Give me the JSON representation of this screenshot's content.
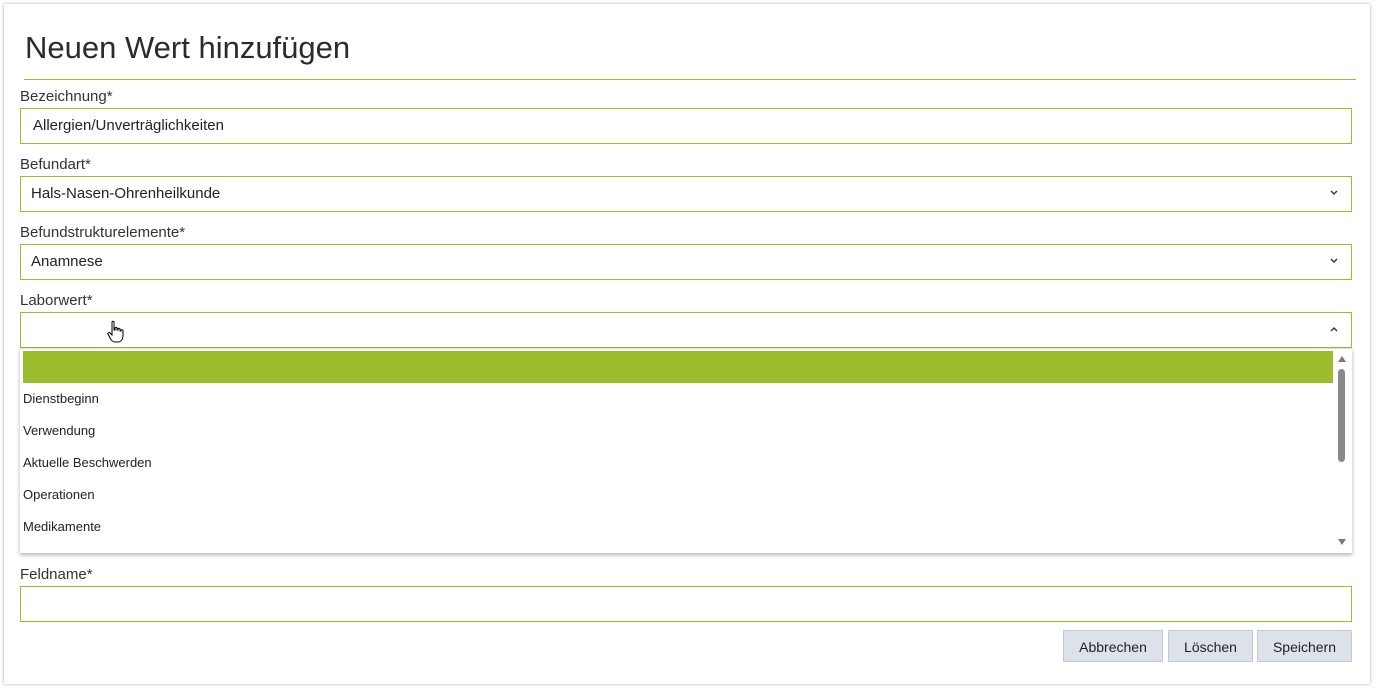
{
  "dialog": {
    "title": "Neuen Wert hinzufügen"
  },
  "fields": {
    "bezeichnung": {
      "label": "Bezeichnung*",
      "value": "Allergien/Unverträglichkeiten"
    },
    "befundart": {
      "label": "Befundart*",
      "value": "Hals-Nasen-Ohrenheilkunde"
    },
    "befundstrukturelemente": {
      "label": "Befundstrukturelemente*",
      "value": "Anamnese"
    },
    "laborwert": {
      "label": "Laborwert*",
      "value": "",
      "options": [
        "",
        "Dienstbeginn",
        "Verwendung",
        "Aktuelle Beschwerden",
        "Operationen",
        "Medikamente"
      ]
    },
    "feldname": {
      "label": "Feldname*",
      "value": ""
    }
  },
  "buttons": {
    "cancel": "Abbrechen",
    "delete": "Löschen",
    "save": "Speichern"
  },
  "icons": {
    "befundart_chevron": "chevron-down-icon",
    "befundstruktur_chevron": "chevron-down-icon",
    "laborwert_chevron": "chevron-up-icon",
    "cursor": "hand-pointer-icon"
  },
  "colors": {
    "accent": "#9bbd2e",
    "button_bg": "#dde2ea",
    "button_border": "#c3cad5"
  }
}
